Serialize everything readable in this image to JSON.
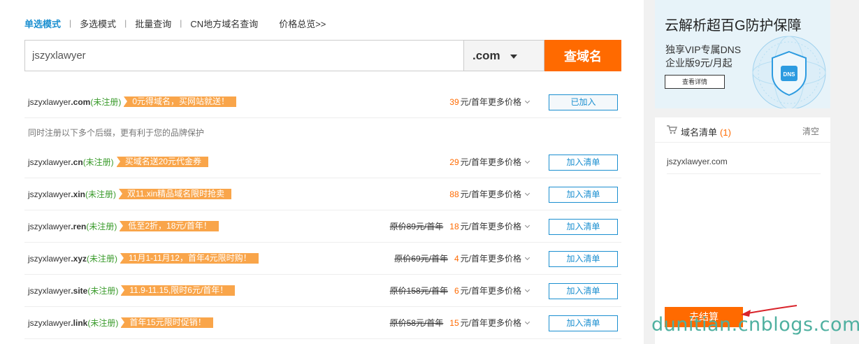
{
  "tabs": [
    {
      "label": "单选模式",
      "active": true
    },
    {
      "label": "多选模式",
      "active": false
    },
    {
      "label": "批量查询",
      "active": false
    },
    {
      "label": "CN地方域名查询",
      "active": false
    }
  ],
  "price_overview_link": "价格总览>>",
  "search": {
    "value": "jszyxlawyer",
    "suffix": ".com",
    "button_label": "查域名"
  },
  "primary_result": {
    "base": "jszyxlawyer",
    "suffix": ".com",
    "status": "(未注册)",
    "promo": "0元得域名，买网站就送！",
    "price": "39",
    "unit": "元/首年",
    "more": "更多价格",
    "button_label": "已加入"
  },
  "related_note": "同时注册以下多个后缀，更有利于您的品牌保护",
  "results": [
    {
      "base": "jszyxlawyer",
      "suffix": ".cn",
      "status": "(未注册)",
      "promo": "买域名送20元代金券",
      "original": "",
      "price": "29",
      "unit": "元/首年",
      "more": "更多价格",
      "button_label": "加入清单"
    },
    {
      "base": "jszyxlawyer",
      "suffix": ".xin",
      "status": "(未注册)",
      "promo": "双11.xin精品域名限时抢卖",
      "original": "",
      "price": "88",
      "unit": "元/首年",
      "more": "更多价格",
      "button_label": "加入清单"
    },
    {
      "base": "jszyxlawyer",
      "suffix": ".ren",
      "status": "(未注册)",
      "promo": "低至2折，18元/首年！",
      "original": "原价89元/首年",
      "price": "18",
      "unit": "元/首年",
      "more": "更多价格",
      "button_label": "加入清单"
    },
    {
      "base": "jszyxlawyer",
      "suffix": ".xyz",
      "status": "(未注册)",
      "promo": "11月1-11月12，首年4元限时购！",
      "original": "原价69元/首年",
      "price": "4",
      "unit": "元/首年",
      "more": "更多价格",
      "button_label": "加入清单"
    },
    {
      "base": "jszyxlawyer",
      "suffix": ".site",
      "status": "(未注册)",
      "promo": "11.9-11.15,限时6元/首年！",
      "original": "原价158元/首年",
      "price": "6",
      "unit": "元/首年",
      "more": "更多价格",
      "button_label": "加入清单"
    },
    {
      "base": "jszyxlawyer",
      "suffix": ".link",
      "status": "(未注册)",
      "promo": "首年15元限时促销！",
      "original": "原价58元/首年",
      "price": "15",
      "unit": "元/首年",
      "more": "更多价格",
      "button_label": "加入清单"
    }
  ],
  "banner": {
    "title": "云解析超百G防护保障",
    "line1": "独享VIP专属DNS",
    "line2": "企业版9元/月起",
    "button": "查看详情",
    "shield_text": "DNS"
  },
  "cart": {
    "title": "域名清单",
    "count": "(1)",
    "clear": "清空",
    "items": [
      "jszyxlawyer.com"
    ],
    "checkout": "去结算"
  },
  "watermark": "dunitian.cnblogs.com",
  "colors": {
    "accent": "#ff6a00",
    "link": "#1b8fd0",
    "status": "#3a9b2b",
    "promo": "#f9a54a"
  }
}
